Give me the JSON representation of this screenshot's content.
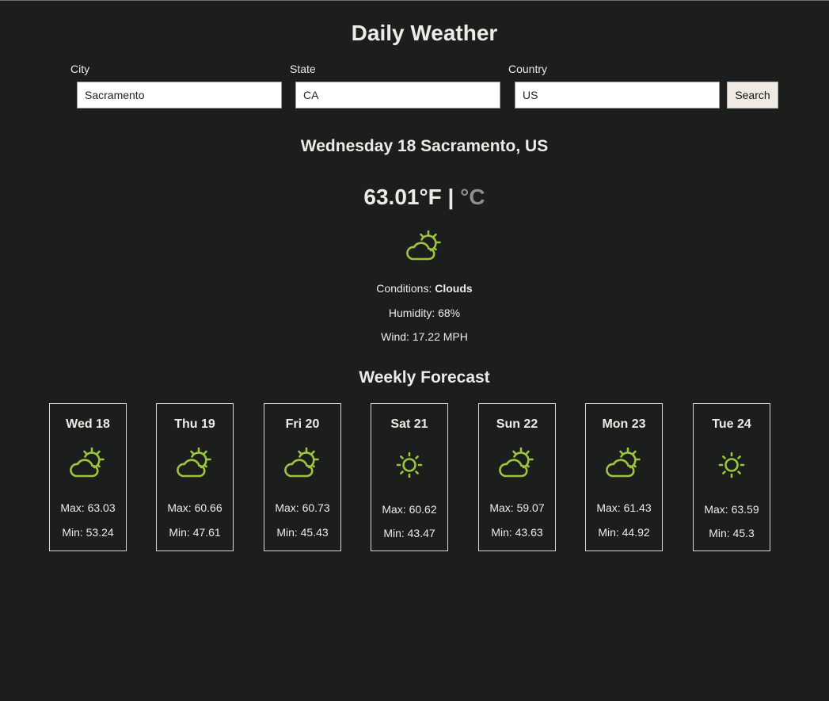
{
  "app": {
    "title": "Daily Weather"
  },
  "search_form": {
    "city_label": "City",
    "city_value": "Sacramento",
    "state_label": "State",
    "state_value": "CA",
    "country_label": "Country",
    "country_value": "US",
    "search_label": "Search"
  },
  "current": {
    "heading": "Wednesday 18 Sacramento, US",
    "temperature": "63.01°F",
    "unit_separator": "|",
    "alt_unit": "°C",
    "icon": "partly-cloudy-icon",
    "conditions_label": "Conditions:",
    "conditions_value": "Clouds",
    "humidity": "Humidity: 68%",
    "wind": "Wind: 17.22 MPH"
  },
  "weekly": {
    "title": "Weekly Forecast",
    "days": [
      {
        "name": "Wed 18",
        "icon": "partly-cloudy-icon",
        "max": "Max: 63.03",
        "min": "Min: 53.24"
      },
      {
        "name": "Thu 19",
        "icon": "partly-cloudy-icon",
        "max": "Max: 60.66",
        "min": "Min: 47.61"
      },
      {
        "name": "Fri 20",
        "icon": "partly-cloudy-icon",
        "max": "Max: 60.73",
        "min": "Min: 45.43"
      },
      {
        "name": "Sat 21",
        "icon": "sun-icon",
        "max": "Max: 60.62",
        "min": "Min: 43.47"
      },
      {
        "name": "Sun 22",
        "icon": "partly-cloudy-icon",
        "max": "Max: 59.07",
        "min": "Min: 43.63"
      },
      {
        "name": "Mon 23",
        "icon": "partly-cloudy-icon",
        "max": "Max: 61.43",
        "min": "Min: 44.92"
      },
      {
        "name": "Tue 24",
        "icon": "sun-icon",
        "max": "Max: 63.59",
        "min": "Min: 45.3"
      }
    ]
  },
  "colors": {
    "background": "#1b1e1c",
    "text": "#ecebe6",
    "icon_accent": "#9bc53d",
    "muted_unit": "#8f8f8f"
  }
}
